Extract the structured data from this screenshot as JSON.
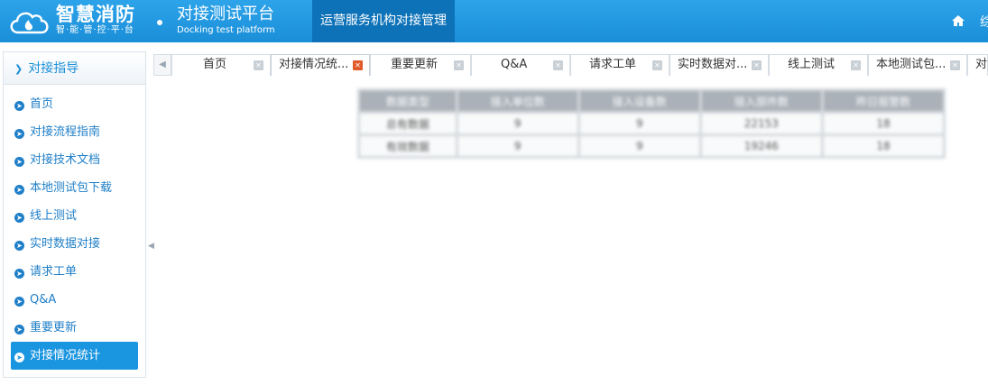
{
  "header": {
    "brand_title": "智慧消防",
    "brand_subtitle": "智·能·管·控·平·台",
    "platform_title": "对接测试平台",
    "platform_subtitle": "Docking test platform",
    "active_nav": "运营服务机构对接管理",
    "right_truncated_text": "综"
  },
  "sidebar": {
    "heading": "对接指导",
    "items": [
      {
        "label": "首页"
      },
      {
        "label": "对接流程指南"
      },
      {
        "label": "对接技术文档"
      },
      {
        "label": "本地测试包下载"
      },
      {
        "label": "线上测试"
      },
      {
        "label": "实时数据对接"
      },
      {
        "label": "请求工单"
      },
      {
        "label": "Q&A"
      },
      {
        "label": "重要更新"
      },
      {
        "label": "对接情况统计"
      }
    ],
    "active_index": 9
  },
  "tabs": [
    {
      "label": "首页"
    },
    {
      "label": "对接情况统..."
    },
    {
      "label": "重要更新"
    },
    {
      "label": "Q&A"
    },
    {
      "label": "请求工单"
    },
    {
      "label": "实时数据对..."
    },
    {
      "label": "线上测试"
    },
    {
      "label": "本地测试包..."
    },
    {
      "label": "对"
    }
  ],
  "active_tab_index": 1,
  "stats_table": {
    "headers": [
      "数据类型",
      "接入单位数",
      "接入设备数",
      "接入部件数",
      "昨日报警数"
    ],
    "rows": [
      [
        "总有数据",
        "9",
        "9",
        "22153",
        "18"
      ],
      [
        "有效数据",
        "9",
        "9",
        "19246",
        "18"
      ]
    ]
  },
  "colors": {
    "header_bg": "#1a8fd8",
    "nav_active_bg": "#0d72b8",
    "accent": "#1f7fc8",
    "active_close": "#e05a2b"
  }
}
